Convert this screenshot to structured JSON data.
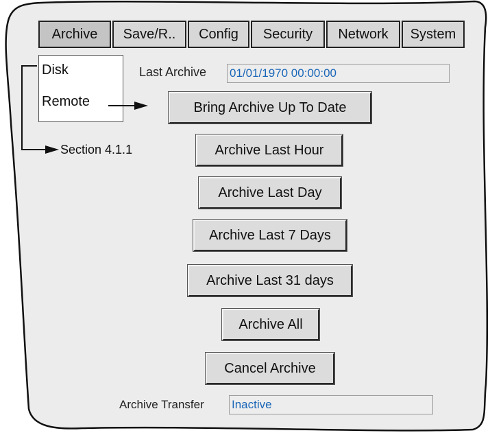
{
  "tabs": [
    {
      "label": "Archive",
      "active": true
    },
    {
      "label": "Save/R..",
      "active": false
    },
    {
      "label": "Config",
      "active": false
    },
    {
      "label": "Security",
      "active": false
    },
    {
      "label": "Network",
      "active": false
    },
    {
      "label": "System",
      "active": false
    }
  ],
  "dropdown": {
    "items": [
      "Disk",
      "Remote"
    ]
  },
  "last_archive": {
    "label": "Last Archive",
    "value": "01/01/1970 00:00:00"
  },
  "buttons": {
    "bring_up_to_date": "Bring Archive Up To Date",
    "last_hour": "Archive Last Hour",
    "last_day": "Archive Last Day",
    "last_7_days": "Archive Last 7 Days",
    "last_31_days": "Archive Last 31 days",
    "all": "Archive All",
    "cancel": "Cancel Archive"
  },
  "archive_transfer": {
    "label": "Archive Transfer",
    "value": "Inactive"
  },
  "annotations": {
    "section_ref": "Section 4.1.1"
  },
  "colors": {
    "panel": "#ececec",
    "field_text": "#1a66b8",
    "border": "#222222"
  }
}
